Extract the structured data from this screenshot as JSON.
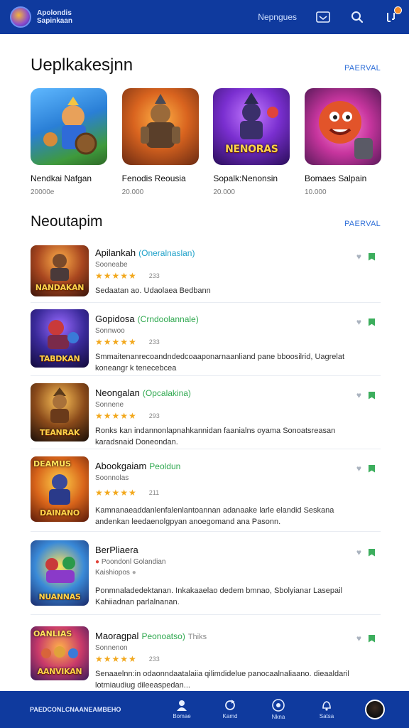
{
  "header": {
    "brand_line1": "Apolondis",
    "brand_line2": "Sapinkaan",
    "link": "Nepngues"
  },
  "featured": {
    "title": "Ueplkakesjnn",
    "link": "PAERVAL",
    "items": [
      {
        "title": "Nendkai Nafgan",
        "count": "20000e",
        "art": "hero-blue"
      },
      {
        "title": "Fenodis Reousia",
        "count": "20.000",
        "art": "warrior-orange"
      },
      {
        "title": "Sopalk:Nenonsin",
        "count": "20.000",
        "art": "purple-squad",
        "art_text": "NENORAS"
      },
      {
        "title": "Bomaes Salpain",
        "count": "10.000",
        "art": "red-character"
      }
    ]
  },
  "list": {
    "title": "Neoutapim",
    "link": "PAERVAL",
    "items": [
      {
        "title": "Apilankah",
        "tag": "(Oneralnaslan)",
        "tag_color": "#1fa1c9",
        "sub": "Sooneabe",
        "stars": "★★★★★",
        "rating": "233",
        "desc": "Sedaatan ao. Udaolaea Bedbann",
        "art_text": "NANDAKAN"
      },
      {
        "title": "Gopidosa",
        "tag": "(Crndoolannale)",
        "tag_color": "#2fa84f",
        "sub": "Sonnwoo",
        "stars": "★★★★★",
        "rating": "233",
        "desc": "Smmaitenanrecoandndedcoaaponarnaanliand pane bboosilrid, Uagrelat koneangr k tenecebcea",
        "art_text": "TABDKAN"
      },
      {
        "title": "Neongalan",
        "tag": "(Opcalakina)",
        "tag_color": "#2fa84f",
        "sub": "Sonnene",
        "stars": "★★★★★",
        "rating": "293",
        "desc": "Ronks kan indannonlapnahkannidan faanialns oyama Sonoatsreasan karadsnaid Doneondan.",
        "art_text": "TEANRAK"
      },
      {
        "title": "Abookgaiam",
        "tag": "Peoldun",
        "tag_color": "#2fa84f",
        "sub": "Soonnolas",
        "stars": "★★★★★",
        "rating": "211",
        "desc": "Kamnanaeaddanlenfalenlantoannan adanaake larle elandid Seskana andenkan leedaenolgpyan anoegomand ana Pasonn.",
        "art_text": "DAINANO",
        "art_top": "DEAMUS"
      },
      {
        "title": "BerPliaera",
        "tag": "",
        "tag_color": "#2fa84f",
        "sub": "Poondonl Golandian",
        "sub2": "Kaishiopos",
        "stars": "",
        "rating": "",
        "desc": "Ponmnaladedektanan. Inkakaaelao dedem bmnao, Sbolyianar Lasepail Kahiiadnan parlalnanan.",
        "art_text": "NUANNAS"
      },
      {
        "title": "Maoragpal",
        "tag": "Peonoatso)",
        "tag_color": "#2fa84f",
        "extra": "Thiks",
        "sub": "Sonnenon",
        "stars": "★★★★★",
        "rating": "233",
        "desc": "Senaaelnn:in odaonndaatalaiia qilimdidelue panocaalnaliaano. dieaaldaril lotmiaudiug dileeaspedan...",
        "art_text": "AANVIKAN",
        "art_top": "OANLIAS"
      }
    ]
  },
  "bottom": {
    "label": "PAEDCONLCNAANEAMBEHO",
    "nav": [
      {
        "label": "Bomae",
        "icon": "person-icon"
      },
      {
        "label": "Kamd",
        "icon": "refresh-icon"
      },
      {
        "label": "Nkna",
        "icon": "info-icon"
      },
      {
        "label": "Satsa",
        "icon": "bell-icon"
      }
    ]
  },
  "colors": {
    "bar": "#0f3a9e",
    "accent": "#2f6fd8",
    "star": "#f2a81d",
    "bookmark": "#3cae5d"
  }
}
